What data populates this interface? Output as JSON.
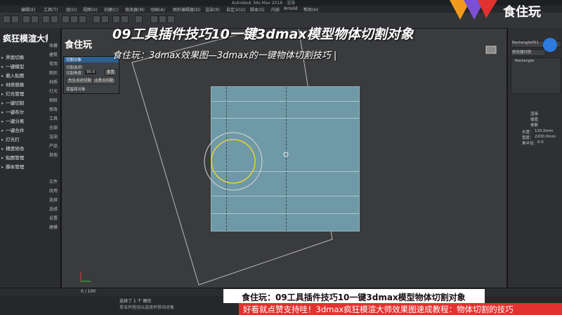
{
  "window": {
    "title": "Autodesk 3ds Max 2018 - 渲染"
  },
  "menu": [
    "编辑(E)",
    "工具(T)",
    "组(G)",
    "视图(V)",
    "创建(C)",
    "修改器(M)",
    "动画(A)",
    "图形编辑器(D)",
    "渲染(R)",
    "自定义(U)",
    "脚本(S)",
    "内容",
    "Arnold",
    "帮助(H)"
  ],
  "left_panel": {
    "brand": "疯狂模渲大师",
    "items": [
      "界面切换",
      "一键模型",
      "载入贴图",
      "材质替换",
      "灯光管理",
      "一键切割",
      "一键布尔",
      "一键分离",
      "一键合并",
      "灯光打",
      "精度修改",
      "贴图管理",
      "脚本管理"
    ]
  },
  "left_column": [
    "收藏",
    "建筑",
    "常用",
    "图形",
    "材质",
    "灯光",
    "相机",
    "修改",
    "工具",
    "全部",
    "渲染",
    "产品",
    "其他",
    "文件",
    "改用",
    "选择",
    "选择",
    "设置",
    "建模"
  ],
  "viewport": {
    "label": "食住玩",
    "overlay_title": "09工具插件技巧10一键3dmax模型物体切割对象",
    "overlay_subtitle": "食住玩：3dmax效果图—3dmax的一键物体切割技巧 |"
  },
  "dialog": {
    "title": "切割对象",
    "row1": "切割选项：",
    "row2": "切割角度：",
    "angle_value": "90.0",
    "btn_reset": "重置",
    "btn_cut": "先生点对切割",
    "btn_confirm": "注意点切割",
    "footer": "保留原对象"
  },
  "right_panel": {
    "object_name": "Rectangle001",
    "modifier_list": "修改器列表",
    "stack_item": "Rectangle",
    "section1": "渲染",
    "section2": "插值",
    "section3": "参数",
    "length_label": "长度：",
    "length_value": "120.0mm",
    "width_label": "宽度：",
    "width_value": "2200.0mm",
    "corner_label": "角半径：",
    "corner_value": "0.0"
  },
  "timeline": {
    "frame": "0 / 100"
  },
  "status": {
    "text": "选择了 1 个 图形",
    "hint": "单击并拖动以选择并移动对象"
  },
  "brand_logo": {
    "name": "食住玩"
  },
  "banners": {
    "line1": "食住玩：09工具插件技巧10一键3dmax模型物体切割对象",
    "line2": "好看就点赞支持哇！3dmax疯狂模渲大师效果图速成教程：物体切割的技巧"
  },
  "colors": {
    "plane": "#6f99a6",
    "banner_red": "#e2322f",
    "dialog_header": "#2f5f8f",
    "circle_yellow": "#e8d23a"
  }
}
